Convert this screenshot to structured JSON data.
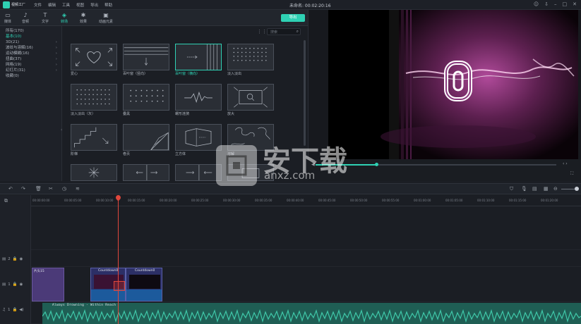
{
  "app": {
    "name": "视频工厂",
    "menu": [
      "文件",
      "编辑",
      "工具",
      "视图",
      "导出",
      "帮助"
    ],
    "window_title": "未命名: 00:02:20:16"
  },
  "toolbar": {
    "tools": [
      {
        "label": "媒体",
        "icon": "folder-icon"
      },
      {
        "label": "音频",
        "icon": "music-icon"
      },
      {
        "label": "文字",
        "icon": "text-icon"
      },
      {
        "label": "转场",
        "icon": "transition-icon",
        "active": true
      },
      {
        "label": "效果",
        "icon": "effects-icon"
      },
      {
        "label": "动画元素",
        "icon": "elements-icon"
      }
    ],
    "export_label": "导出"
  },
  "sidebar": {
    "items": [
      {
        "label": "所有(170)"
      },
      {
        "label": "基本(10)",
        "active": true
      },
      {
        "label": "3D(21)",
        "has_children": true
      },
      {
        "label": "波纹与溶解(16)",
        "has_children": true
      },
      {
        "label": "运动模糊(16)",
        "has_children": true
      },
      {
        "label": "扭曲(37)",
        "has_children": true
      },
      {
        "label": "网格(19)",
        "has_children": true
      },
      {
        "label": "幻灯片(31)",
        "has_children": true
      },
      {
        "label": "收藏(0)"
      }
    ]
  },
  "content": {
    "search_placeholder": "搜索",
    "transitions": [
      {
        "label": "爱心",
        "selected": false
      },
      {
        "label": "百叶窗（竖向）",
        "selected": false
      },
      {
        "label": "百叶窗（横向）",
        "selected": true
      },
      {
        "label": "淡入淡出",
        "selected": false
      },
      {
        "label": "淡入淡出（灰）",
        "selected": false
      },
      {
        "label": "叠黑",
        "selected": false
      },
      {
        "label": "螺形涟漪",
        "selected": false
      },
      {
        "label": "放大",
        "selected": false
      },
      {
        "label": "阶梯",
        "selected": false
      },
      {
        "label": "卷页",
        "selected": false
      },
      {
        "label": "立方体",
        "selected": false
      },
      {
        "label": "溶解",
        "selected": false
      },
      {
        "label": "",
        "selected": false
      },
      {
        "label": "",
        "selected": false
      },
      {
        "label": "",
        "selected": false
      },
      {
        "label": "",
        "selected": false
      }
    ]
  },
  "preview": {
    "countdown_digit": "0"
  },
  "timeline": {
    "ruler_labels": [
      "00:00:00:00",
      "00:00:05:00",
      "00:00:10:00",
      "00:00:15:00",
      "00:00:20:00",
      "00:00:25:00",
      "00:00:30:00",
      "00:00:35:00",
      "00:00:40:00",
      "00:00:45:00",
      "00:00:50:00",
      "00:00:55:00",
      "00:01:00:00",
      "00:01:05:00",
      "00:01:10:00",
      "00:01:15:00",
      "00:01:20:00"
    ],
    "tracks": [
      {
        "id": "2",
        "type": "video"
      },
      {
        "id": "1",
        "type": "video"
      },
      {
        "id": "1",
        "type": "audio"
      }
    ],
    "clips": {
      "title_clip": "片头15",
      "countdown_a": "Countdown0",
      "countdown_b": "Countdown0",
      "audio_clip": "Always Drowning - Within Reach"
    }
  },
  "watermark": {
    "text": "安下载",
    "sub": "anxz.com"
  },
  "colors": {
    "accent": "#2fd1b4",
    "playhead": "#e0473c",
    "title_clip": "#4b3a78",
    "audio": "#1f7e6c"
  }
}
